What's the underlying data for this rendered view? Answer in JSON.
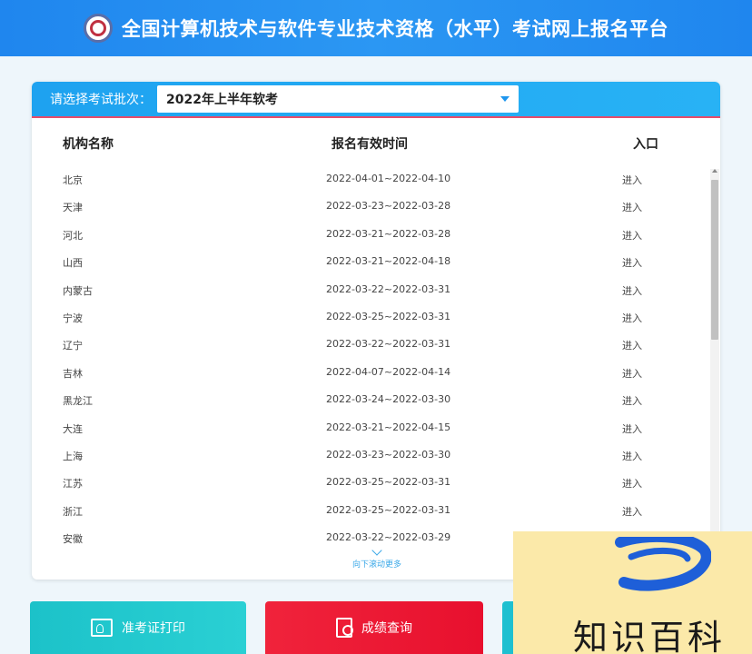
{
  "header": {
    "title": "全国计算机技术与软件专业技术资格（水平）考试网上报名平台"
  },
  "batch": {
    "label": "请选择考试批次：",
    "selected": "2022年上半年软考"
  },
  "table": {
    "columns": [
      "机构名称",
      "报名有效时间",
      "入口"
    ],
    "rows": [
      {
        "name": "北京",
        "period": "2022-04-01~2022-04-10",
        "entry": "进入"
      },
      {
        "name": "天津",
        "period": "2022-03-23~2022-03-28",
        "entry": "进入"
      },
      {
        "name": "河北",
        "period": "2022-03-21~2022-03-28",
        "entry": "进入"
      },
      {
        "name": "山西",
        "period": "2022-03-21~2022-04-18",
        "entry": "进入"
      },
      {
        "name": "内蒙古",
        "period": "2022-03-22~2022-03-31",
        "entry": "进入"
      },
      {
        "name": "宁波",
        "period": "2022-03-25~2022-03-31",
        "entry": "进入"
      },
      {
        "name": "辽宁",
        "period": "2022-03-22~2022-03-31",
        "entry": "进入"
      },
      {
        "name": "吉林",
        "period": "2022-04-07~2022-04-14",
        "entry": "进入"
      },
      {
        "name": "黑龙江",
        "period": "2022-03-24~2022-03-30",
        "entry": "进入"
      },
      {
        "name": "大连",
        "period": "2022-03-21~2022-04-15",
        "entry": "进入"
      },
      {
        "name": "上海",
        "period": "2022-03-23~2022-03-30",
        "entry": "进入"
      },
      {
        "name": "江苏",
        "period": "2022-03-25~2022-03-31",
        "entry": "进入"
      },
      {
        "name": "浙江",
        "period": "2022-03-25~2022-03-31",
        "entry": "进入"
      },
      {
        "name": "安徽",
        "period": "2022-03-22~2022-03-29",
        "entry": ""
      }
    ]
  },
  "scroll_more": "向下滚动更多",
  "buttons": {
    "ticket_print": "准考证打印",
    "score_query": "成绩查询"
  },
  "watermark": {
    "text": "知识百科"
  },
  "colors": {
    "header_blue": "#1f86ee",
    "panel_top": "#1ea2f0",
    "teal": "#1cc2c9",
    "red": "#e8102e",
    "link": "#3aa8e8"
  }
}
